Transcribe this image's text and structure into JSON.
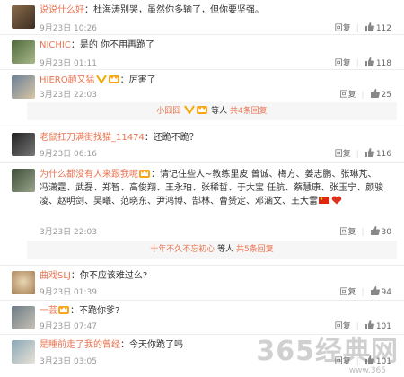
{
  "comments": [
    {
      "user": "说说什么好",
      "text": "：杜海涛别哭，虽然你多输了，但你要坚强。",
      "time": "9月23日 10:26",
      "reply": "回复",
      "likes": "112"
    },
    {
      "user": "NICHIC",
      "text": "：是的 你不用再跪了",
      "time": "9月23日 01:11",
      "reply": "回复",
      "likes": "118"
    },
    {
      "user": "HIERO趟又猛",
      "text": "：厉害了",
      "time": "3月23日 22:03",
      "reply": "回复",
      "likes": "25",
      "sub_reply": {
        "user": "小囧囧",
        "mid": "等人",
        "link": "共4条回复"
      }
    },
    {
      "user": "老鼠扛刀满街找猫_11474",
      "text": "：还跪不跪？",
      "time": "9月23日 06:16",
      "reply": "回复",
      "likes": "116"
    },
    {
      "user": "为什么都没有人来跟我呢",
      "text": "：请记住些人~教练里皮 曾诚、梅方、姜志鹏、张琳芃、冯潇霆、武磊、郑智、高俊翔、王永珀、张稀哲、于大宝 任航、蔡慧康、张玉宁、颜骏凌、赵明剑、吴曦、范晓东、尹鸿博、郜林、曹赟定、邓涵文、王大雷",
      "time": "3月23日 22:03",
      "reply": "回复",
      "likes": "30",
      "sub_reply": {
        "user": "十年不久不忘初心",
        "mid": "等人",
        "link": "共5条回复"
      }
    },
    {
      "user": "曲戏SLJ",
      "text": "：你不应该难过么?",
      "time": "9月23日 01:39",
      "reply": "回复",
      "likes": "94"
    },
    {
      "user": "一芸",
      "text": "：不跪你爹?",
      "time": "9月23日 07:47",
      "reply": "回复",
      "likes": "101"
    },
    {
      "user": "是睡前走了我的曾经",
      "text": "：今天你跪了吗",
      "time": "3月23日 03:05",
      "reply": "回复",
      "likes": "101"
    }
  ],
  "watermark": "365经典网",
  "watermark_sub": "www.365"
}
